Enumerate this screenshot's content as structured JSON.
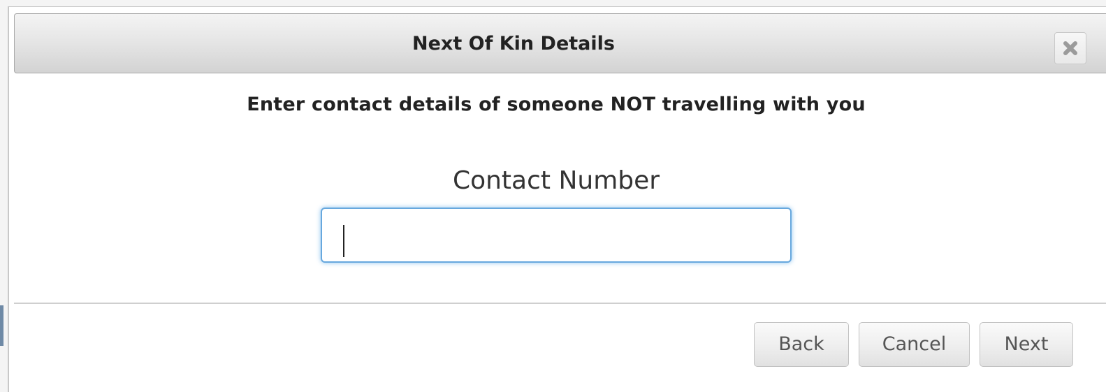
{
  "dialog": {
    "title": "Next Of Kin Details",
    "close_icon": "close-icon"
  },
  "form": {
    "instruction": "Enter contact details of someone NOT travelling with you",
    "contact_number": {
      "label": "Contact Number",
      "value": "",
      "placeholder": ""
    }
  },
  "footer": {
    "back_label": "Back",
    "cancel_label": "Cancel",
    "next_label": "Next"
  },
  "colors": {
    "focus_border": "#67a8de",
    "titlebar": "#e6e6e6",
    "button_text": "#555555"
  }
}
